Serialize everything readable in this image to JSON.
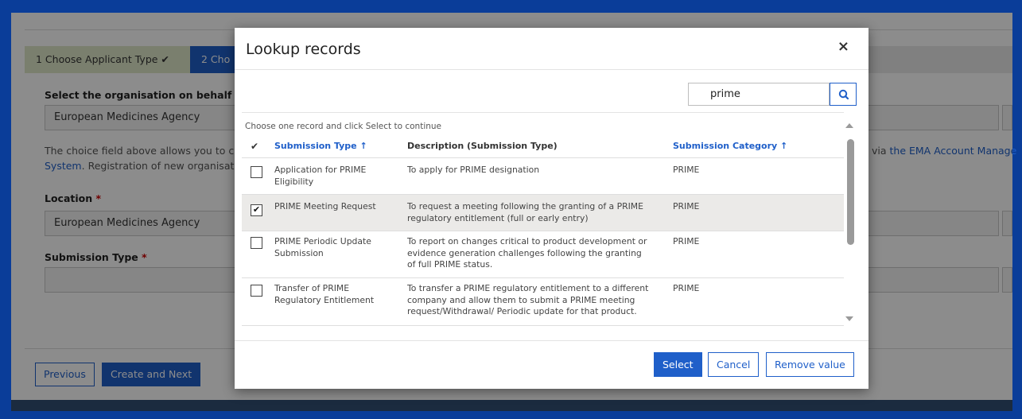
{
  "steps": [
    {
      "label": "1  Choose Applicant Type  ✔"
    },
    {
      "label": "2  Cho"
    }
  ],
  "form": {
    "org_label": "Select the organisation on behalf o",
    "org_value": "European Medicines Agency",
    "help_left1": "The choice field above allows you to ch",
    "help_left2": "System",
    "help_left2_rest": ". Registration of new organisati",
    "help_right_prefix": "via ",
    "help_right_link": "the EMA Account Manage",
    "location_label": "Location",
    "location_value": "European Medicines Agency",
    "submission_type_label": "Submission Type",
    "required_mark": "*"
  },
  "footer": {
    "previous": "Previous",
    "create_next": "Create and Next"
  },
  "modal": {
    "title": "Lookup records",
    "close": "×",
    "search_value": "prime",
    "hint": "Choose one record and click Select to continue",
    "columns": {
      "check": "✔",
      "submission_type": "Submission Type ↑",
      "description": "Description (Submission Type)",
      "category": "Submission Category ↑"
    },
    "rows": [
      {
        "type": "Application for PRIME Eligibility",
        "description": "To apply for PRIME designation",
        "category": "PRIME",
        "checked": false
      },
      {
        "type": "PRIME Meeting Request",
        "description": "To request a meeting following the granting of a PRIME regulatory entitlement (full or early entry)",
        "category": "PRIME",
        "checked": true
      },
      {
        "type": "PRIME Periodic Update Submission",
        "description": "To report on changes critical to product development or evidence generation challenges following the granting of full PRIME status.",
        "category": "PRIME",
        "checked": false
      },
      {
        "type": "Transfer of PRIME Regulatory Entitlement",
        "description": "To transfer a PRIME regulatory entitlement to a different company and allow them to submit a PRIME meeting request/Withdrawal/ Periodic update for that product.",
        "category": "PRIME",
        "checked": false
      }
    ],
    "buttons": {
      "select": "Select",
      "cancel": "Cancel",
      "remove": "Remove value"
    }
  },
  "colors": {
    "accent": "#1f5fc9",
    "frame": "#0a3d99",
    "step_done": "#dfe8c9",
    "required": "#cc0000"
  },
  "icons": {
    "search": "search-icon",
    "close": "close-icon",
    "check": "check-icon"
  }
}
